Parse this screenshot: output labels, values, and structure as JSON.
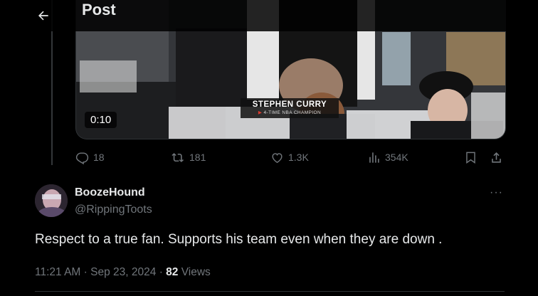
{
  "header": {
    "title": "Post",
    "back_icon": "arrow-left-icon"
  },
  "video": {
    "duration": "0:10",
    "overlay_name": "STEPHEN CURRY",
    "overlay_sub": "4-TIME NBA CHAMPION"
  },
  "actions": {
    "replies": "18",
    "reposts": "181",
    "likes": "1.3K",
    "views": "354K",
    "icons": [
      "reply-icon",
      "repost-icon",
      "like-icon",
      "views-icon",
      "bookmark-icon",
      "share-icon"
    ]
  },
  "reply": {
    "name": "BoozeHound",
    "handle": "@RippingToots",
    "more": "···",
    "text": "Respect to a true fan. Supports his team even when they are down .",
    "time": "11:21 AM",
    "sep1": "·",
    "date": "Sep 23, 2024",
    "sep2": "·",
    "view_count": "82",
    "views_label": "Views"
  },
  "colors": {
    "background": "#000000",
    "text": "#e7e9ea",
    "muted": "#71767b",
    "border": "#2f3336"
  }
}
